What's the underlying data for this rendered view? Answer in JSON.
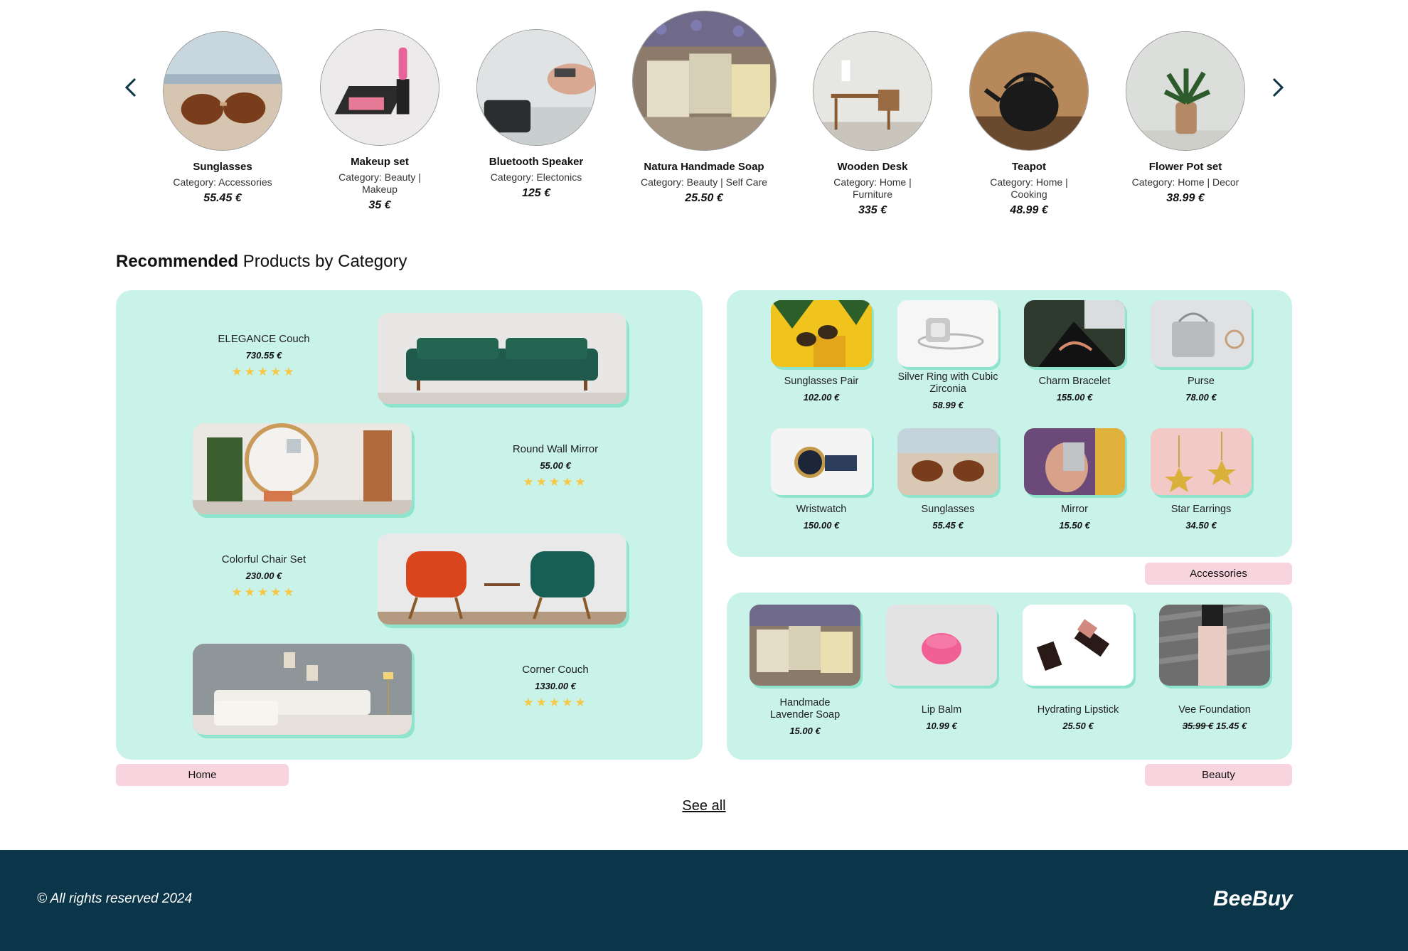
{
  "carousel": {
    "prev_icon": "chevron-left-icon",
    "next_icon": "chevron-right-icon",
    "items": [
      {
        "name": "Sunglasses",
        "category": "Category: Accessories",
        "price": "55.45 €"
      },
      {
        "name": "Makeup set",
        "category": "Category: Beauty | Makeup",
        "price": "35 €"
      },
      {
        "name": "Bluetooth Speaker",
        "category": "Category: Electonics",
        "price": "125 €"
      },
      {
        "name": "Natura Handmade Soap",
        "category": "Category: Beauty | Self Care",
        "price": "25.50 €"
      },
      {
        "name": "Wooden Desk",
        "category": "Category: Home | Furniture",
        "price": "335 €"
      },
      {
        "name": "Teapot",
        "category": "Category: Home | Cooking",
        "price": "48.99 €"
      },
      {
        "name": "Flower Pot set",
        "category": "Category: Home | Decor",
        "price": "38.99 €"
      }
    ]
  },
  "section": {
    "title_bold": "Recommended",
    "title_rest": " Products by Category"
  },
  "home": {
    "tag": "Home",
    "items": [
      {
        "name": "ELEGANCE Couch",
        "price": "730.55 €",
        "stars": "★★★★★",
        "rating": 5
      },
      {
        "name": "Round Wall Mirror",
        "price": "55.00 €",
        "stars": "★★★★★",
        "rating": 5
      },
      {
        "name": "Colorful Chair Set",
        "price": "230.00 €",
        "stars": "★★★★★",
        "rating": 5
      },
      {
        "name": "Corner Couch",
        "price": "1330.00 €",
        "stars": "★★★★★",
        "rating": 5
      }
    ]
  },
  "accessories": {
    "tag": "Accessories",
    "items": [
      {
        "name": "Sunglasses Pair",
        "price": "102.00 €"
      },
      {
        "name": "Silver Ring with Cubic Zirconia",
        "price": "58.99 €"
      },
      {
        "name": "Charm Bracelet",
        "price": "155.00 €"
      },
      {
        "name": "Purse",
        "price": "78.00 €"
      },
      {
        "name": "Wristwatch",
        "price": "150.00 €"
      },
      {
        "name": "Sunglasses",
        "price": "55.45 €"
      },
      {
        "name": "Mirror",
        "price": "15.50 €"
      },
      {
        "name": "Star Earrings",
        "price": "34.50 €"
      }
    ]
  },
  "beauty": {
    "tag": "Beauty",
    "items": [
      {
        "name": "Handmade Lavender Soap",
        "price": "15.00 €"
      },
      {
        "name": "Lip Balm",
        "price": "10.99 €"
      },
      {
        "name": "Hydrating Lipstick",
        "price": "25.50 €"
      },
      {
        "name": "Vee Foundation",
        "old_price": "35.99 €",
        "price": "15.45 €"
      }
    ]
  },
  "see_all": "See all",
  "footer": {
    "copyright": "© All rights reserved 2024",
    "brand": "BeeBuy"
  },
  "colors": {
    "panel": "#c9f3e8",
    "tag": "#f8d5de",
    "footer": "#0b3548",
    "star": "#f7c846",
    "shadow": "#8ee4cc"
  }
}
